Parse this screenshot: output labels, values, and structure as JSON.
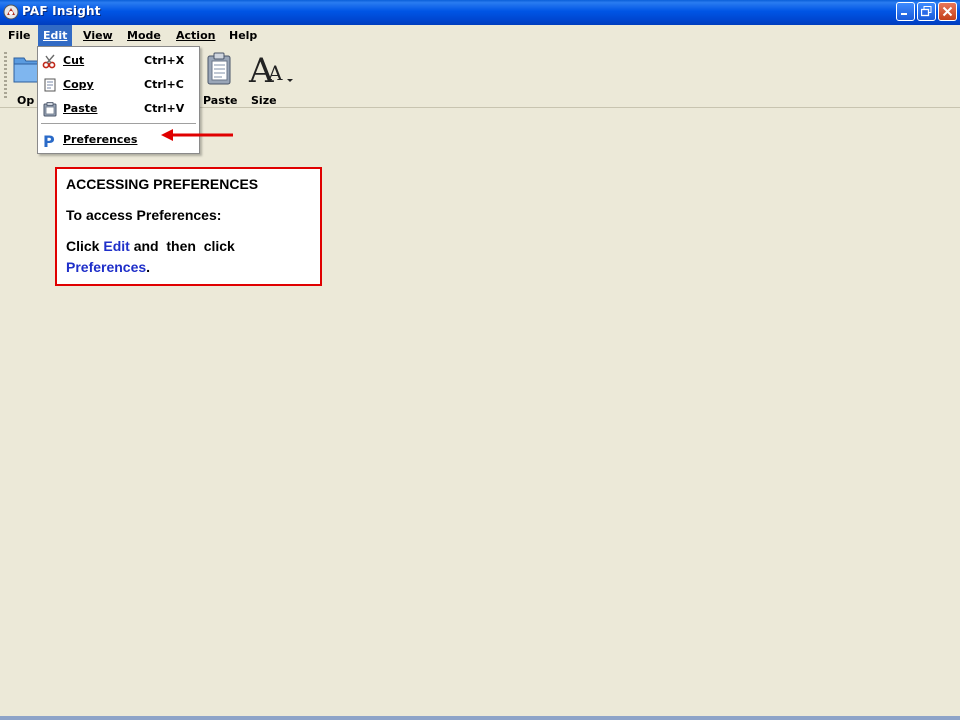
{
  "window": {
    "title": "PAF Insight",
    "icons": {
      "app": "paf-app-icon",
      "minimize": "minimize-icon",
      "maximize": "restore-icon",
      "close": "close-icon"
    }
  },
  "menubar": {
    "items": [
      {
        "label": "File",
        "mnemonic": "F"
      },
      {
        "label": "Edit",
        "mnemonic": "E",
        "active": true
      },
      {
        "label": "View",
        "mnemonic": "V"
      },
      {
        "label": "Mode",
        "mnemonic": "M"
      },
      {
        "label": "Action",
        "mnemonic": "A"
      },
      {
        "label": "Help",
        "mnemonic": "H"
      }
    ]
  },
  "toolbar": {
    "items": [
      {
        "label": "Op",
        "icon": "folder-open-icon"
      },
      {
        "label": "Paste",
        "icon": "clipboard-paste-icon"
      },
      {
        "label": "Size",
        "icon": "font-size-icon"
      }
    ]
  },
  "edit_menu": {
    "items": [
      {
        "label": "Cut",
        "shortcut": "Ctrl+X",
        "icon": "scissors-icon"
      },
      {
        "label": "Copy",
        "shortcut": "Ctrl+C",
        "icon": "copy-icon"
      },
      {
        "label": "Paste",
        "shortcut": "Ctrl+V",
        "icon": "clipboard-icon"
      },
      {
        "label": "Preferences",
        "shortcut": "",
        "icon": "preferences-p-icon"
      }
    ]
  },
  "callout": {
    "heading": "ACCESSING  PREFERENCES",
    "line1": "To access  Preferences:",
    "line2_prefix": "Click ",
    "line2_edit": "Edit",
    "line2_middle": " and  then  click",
    "line3_pref": "Preferences",
    "line3_suffix": "."
  },
  "colors": {
    "titlebar": "#0055e5",
    "menu_active": "#316ac5",
    "callout_border": "#e00000",
    "callout_link": "#1f2fc9",
    "background": "#ece9d8",
    "arrow": "#e00000"
  }
}
